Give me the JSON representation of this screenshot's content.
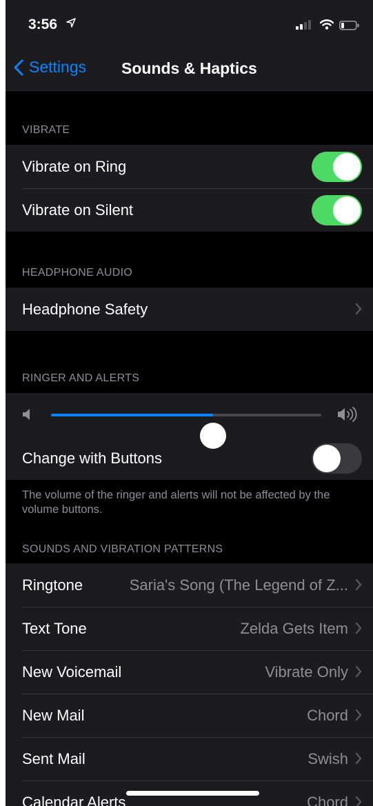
{
  "status": {
    "time": "3:56"
  },
  "nav": {
    "back_label": "Settings",
    "title": "Sounds & Haptics"
  },
  "vibrate": {
    "header": "VIBRATE",
    "ring_label": "Vibrate on Ring",
    "ring_on": true,
    "silent_label": "Vibrate on Silent",
    "silent_on": true
  },
  "headphone": {
    "header": "HEADPHONE AUDIO",
    "safety_label": "Headphone Safety"
  },
  "ringer": {
    "header": "RINGER AND ALERTS",
    "volume_fraction": 0.6,
    "change_label": "Change with Buttons",
    "change_on": false,
    "footnote": "The volume of the ringer and alerts will not be affected by the volume buttons."
  },
  "sounds": {
    "header": "SOUNDS AND VIBRATION PATTERNS",
    "rows": [
      {
        "label": "Ringtone",
        "value": "Saria's Song (The Legend of Z..."
      },
      {
        "label": "Text Tone",
        "value": "Zelda Gets Item"
      },
      {
        "label": "New Voicemail",
        "value": "Vibrate Only"
      },
      {
        "label": "New Mail",
        "value": "Chord"
      },
      {
        "label": "Sent Mail",
        "value": "Swish"
      },
      {
        "label": "Calendar Alerts",
        "value": "Chord"
      }
    ]
  },
  "colors": {
    "accent": "#0a84ff",
    "toggle_on": "#4cd964",
    "background": "#000000",
    "cell": "#1c1c1e"
  }
}
